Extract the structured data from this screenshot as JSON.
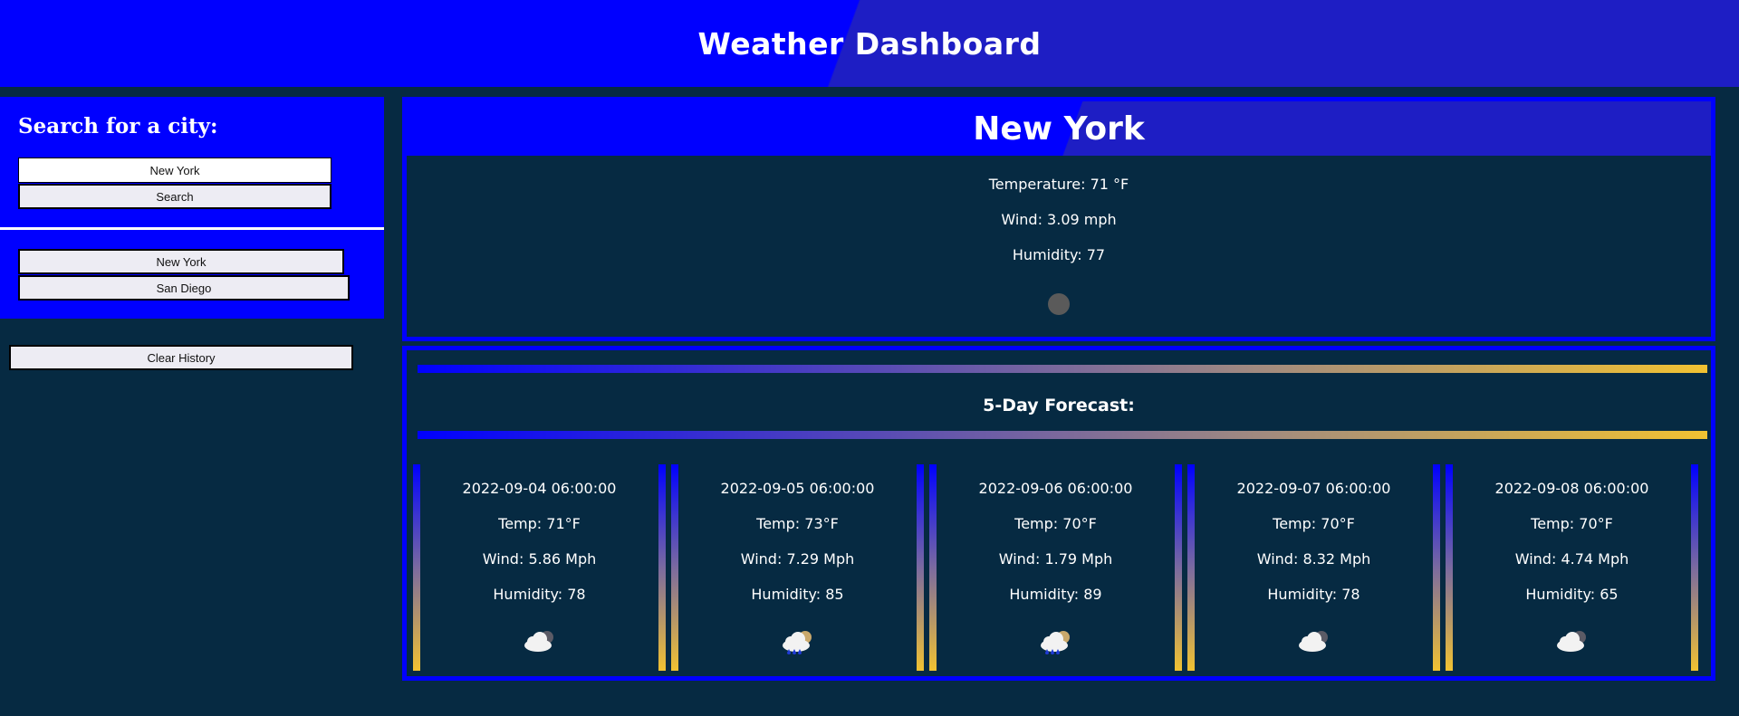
{
  "header": {
    "title": "Weather Dashboard"
  },
  "search": {
    "heading": "Search for a city:",
    "input_value": "New York",
    "search_label": "Search",
    "history": [
      "New York",
      "San Diego"
    ],
    "clear_label": "Clear History"
  },
  "current": {
    "city": "New York",
    "temperature": "Temperature: 71 °F",
    "wind": "Wind: 3.09 mph",
    "humidity": "Humidity: 77",
    "icon": "broken-image-icon"
  },
  "forecast": {
    "title": "5-Day Forecast:",
    "days": [
      {
        "date": "2022-09-04 06:00:00",
        "temp": "Temp: 71°F",
        "wind": "Wind: 5.86 Mph",
        "humidity": "Humidity: 78",
        "icon": "cloudy-icon"
      },
      {
        "date": "2022-09-05 06:00:00",
        "temp": "Temp: 73°F",
        "wind": "Wind: 7.29 Mph",
        "humidity": "Humidity: 85",
        "icon": "rain-cloud-icon"
      },
      {
        "date": "2022-09-06 06:00:00",
        "temp": "Temp: 70°F",
        "wind": "Wind: 1.79 Mph",
        "humidity": "Humidity: 89",
        "icon": "rain-cloud-icon"
      },
      {
        "date": "2022-09-07 06:00:00",
        "temp": "Temp: 70°F",
        "wind": "Wind: 8.32 Mph",
        "humidity": "Humidity: 78",
        "icon": "cloudy-icon"
      },
      {
        "date": "2022-09-08 06:00:00",
        "temp": "Temp: 70°F",
        "wind": "Wind: 4.74 Mph",
        "humidity": "Humidity: 65",
        "icon": "cloudy-icon"
      }
    ]
  },
  "colors": {
    "accent": "#0000ff",
    "background": "#062a42",
    "gradient_end": "#f1c232"
  }
}
